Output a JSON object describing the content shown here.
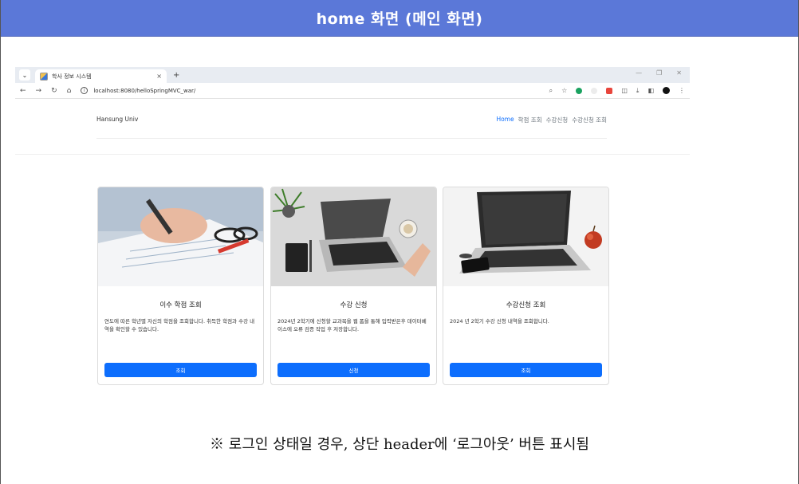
{
  "banner": {
    "title": "home 화면 (메인 화면)"
  },
  "browser": {
    "tab_title": "학사 정보 시스템",
    "tab_close": "×",
    "new_tab": "+",
    "url": "localhost:8080/helloSpringMVC_war/"
  },
  "site": {
    "brand": "Hansung Univ",
    "nav": [
      "Home",
      "학점 조회",
      "수강신청",
      "수강신청 조회"
    ]
  },
  "cards": [
    {
      "title": "이수 학점 조회",
      "text": "연도에 따른 학년별 자신의 학점을 조회합니다. 취득한 학점과 수강 내역을 확인할 수 있습니다.",
      "button": "조회"
    },
    {
      "title": "수강 신청",
      "text": "2024년 2학기에 신청할 교과목을 웹 폼을 통해 입력받은후 데이터베이스에 오류 검증 작업 후 저장합니다.",
      "button": "신청"
    },
    {
      "title": "수강신청 조회",
      "text": "2024 년 2학기 수강 신청 내역을 조회합니다.",
      "button": "조회"
    }
  ],
  "note": "※ 로그인 상태일 경우, 상단 header에 ‘로그아웃’ 버튼 표시됨",
  "colors": {
    "banner": "#5b78d8",
    "primary_button": "#0d6efd"
  },
  "icons": [
    "tab-list-icon",
    "back-icon",
    "forward-icon",
    "reload-icon",
    "home-icon",
    "site-info-icon",
    "zoom-icon",
    "star-icon",
    "download-icon",
    "sidepanel-icon",
    "profile-icon",
    "menu-icon"
  ]
}
